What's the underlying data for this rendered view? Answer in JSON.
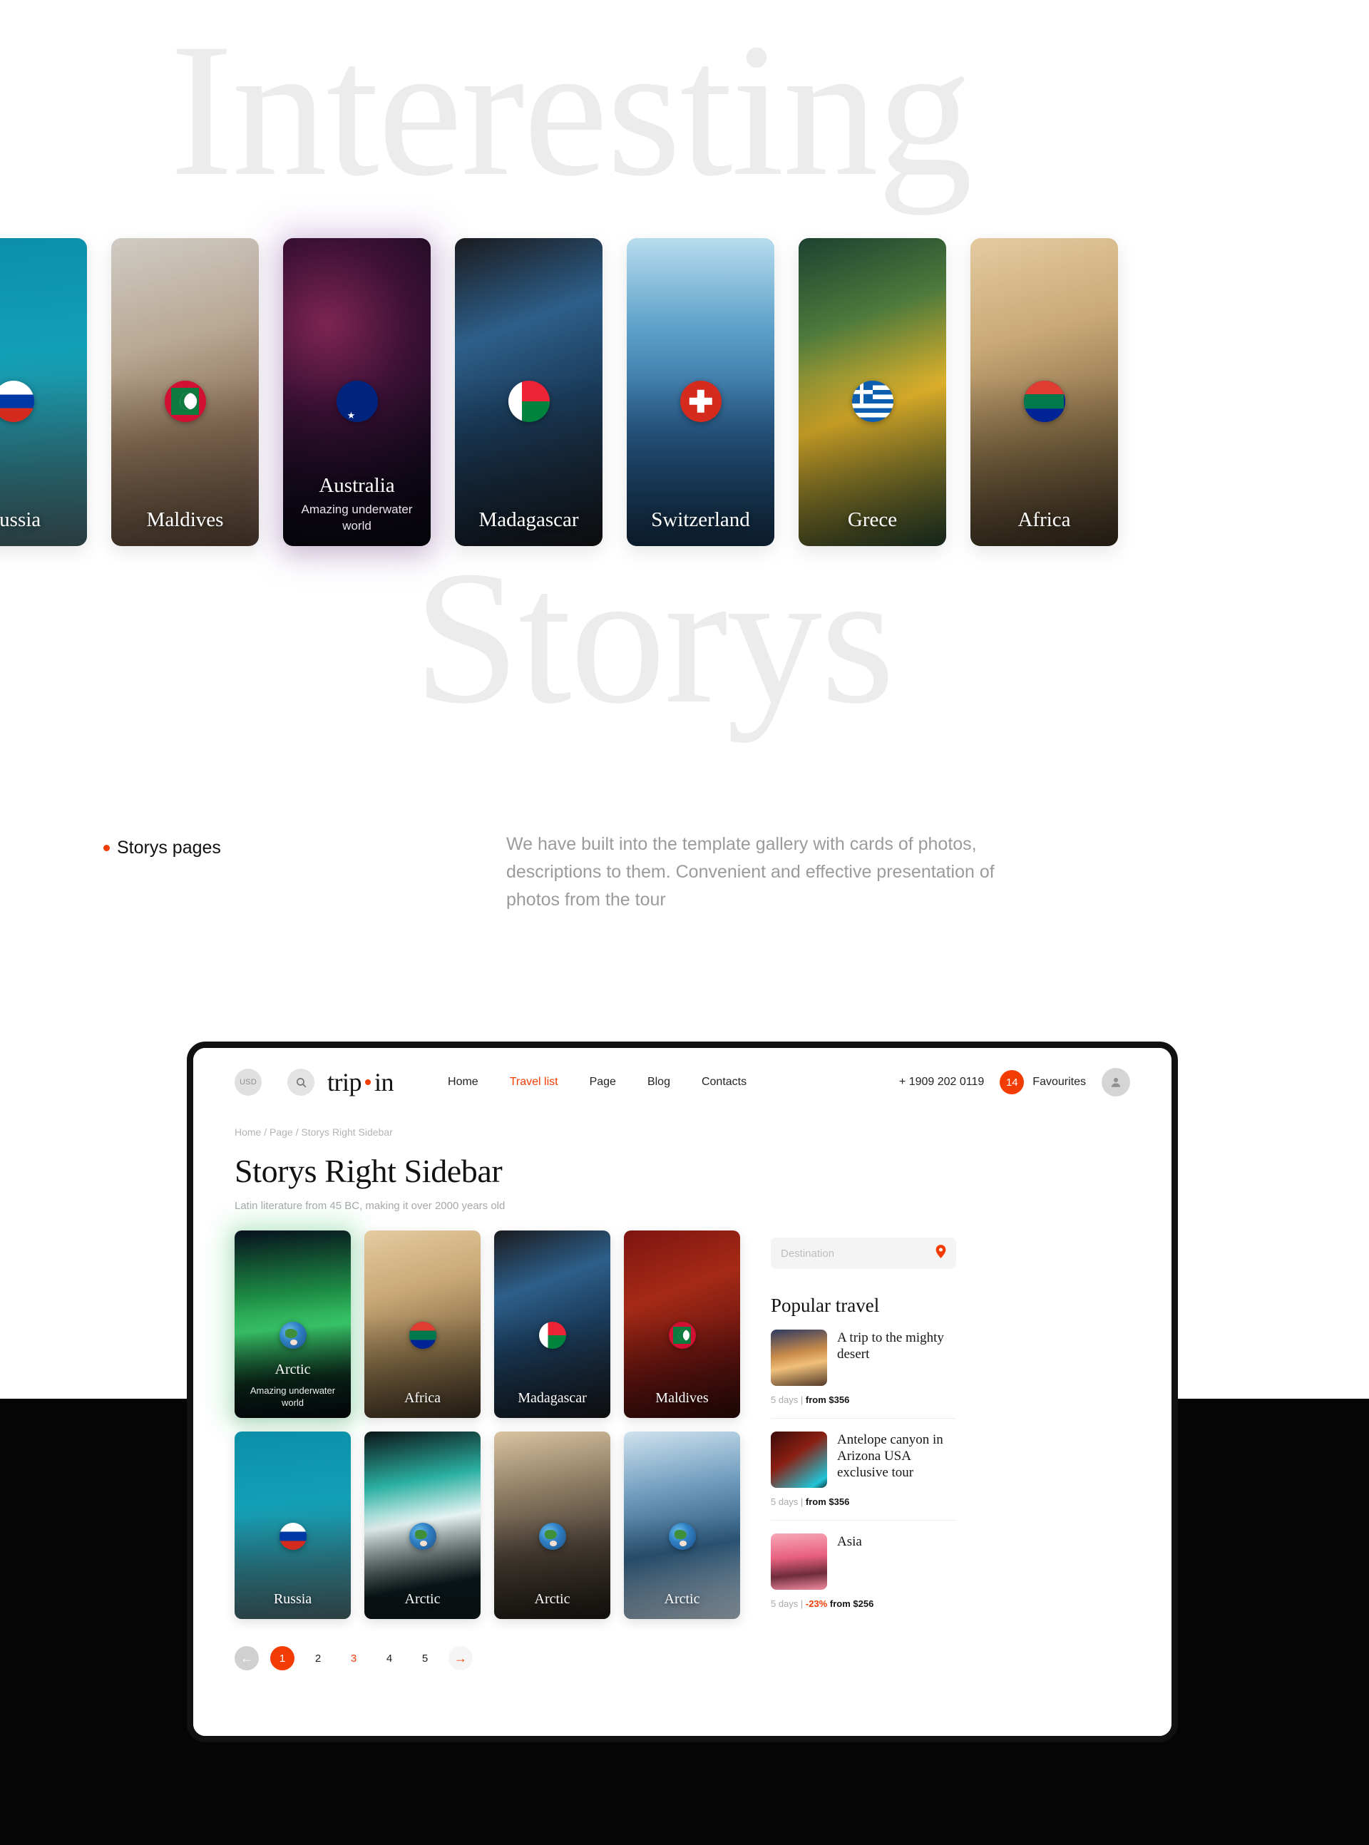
{
  "hero": {
    "watermark_top": "Interesting",
    "watermark_bottom": "Storys",
    "cards": [
      {
        "caption": "Russia",
        "subtitle": "",
        "flag": "flag-ru",
        "photo": "img-balloons",
        "featured": false
      },
      {
        "caption": "Maldives",
        "subtitle": "",
        "flag": "flag-mv",
        "photo": "img-pool",
        "featured": false
      },
      {
        "caption": "Australia",
        "subtitle": "Amazing underwater world",
        "flag": "flag-au",
        "photo": "img-jelly",
        "featured": true
      },
      {
        "caption": "Madagascar",
        "subtitle": "",
        "flag": "flag-mg",
        "photo": "img-bird",
        "featured": false
      },
      {
        "caption": "Switzerland",
        "subtitle": "",
        "flag": "flag-ch",
        "photo": "img-alps",
        "featured": false
      },
      {
        "caption": "Grece",
        "subtitle": "",
        "flag": "flag-gr",
        "photo": "img-lemon",
        "featured": false
      },
      {
        "caption": "Africa",
        "subtitle": "",
        "flag": "flag-za",
        "photo": "img-dune",
        "featured": false
      }
    ]
  },
  "intro": {
    "label": "Storys pages",
    "body": "We have built into the template gallery with cards of photos, descriptions to them. Convenient and effective presentation of photos from the tour"
  },
  "browser": {
    "topbar": {
      "currency": "USD",
      "search_icon": "search-icon",
      "logo_left": "trip",
      "logo_right": "in",
      "nav": [
        {
          "label": "Home",
          "active": false
        },
        {
          "label": "Travel list",
          "active": true
        },
        {
          "label": "Page",
          "active": false
        },
        {
          "label": "Blog",
          "active": false
        },
        {
          "label": "Contacts",
          "active": false
        }
      ],
      "phone": "+ 1909 202 0119",
      "favourites_count": "14",
      "favourites_label": "Favourites",
      "account_icon": "user-icon"
    },
    "breadcrumb": "Home / Page / Storys Right Sidebar",
    "page_title": "Storys Right Sidebar",
    "lede": "Latin literature from 45 BC, making it over 2000 years old",
    "gallery": [
      {
        "caption": "Arctic",
        "subtitle": "Amazing underwater world",
        "flag": "flag-globe",
        "photo": "img-aurora",
        "glow": true
      },
      {
        "caption": "Africa",
        "subtitle": "",
        "flag": "flag-za",
        "photo": "img-dune",
        "glow": false
      },
      {
        "caption": "Madagascar",
        "subtitle": "",
        "flag": "flag-mg",
        "photo": "img-bird",
        "glow": false
      },
      {
        "caption": "Maldives",
        "subtitle": "",
        "flag": "flag-mv",
        "photo": "img-maldives",
        "glow": false
      },
      {
        "caption": "Russia",
        "subtitle": "",
        "flag": "flag-ru",
        "photo": "img-balloons",
        "glow": false
      },
      {
        "caption": "Arctic",
        "subtitle": "",
        "flag": "flag-globe",
        "photo": "img-ice",
        "glow": false
      },
      {
        "caption": "Arctic",
        "subtitle": "",
        "flag": "flag-globe",
        "photo": "img-penguin",
        "glow": false
      },
      {
        "caption": "Arctic",
        "subtitle": "",
        "flag": "flag-globe",
        "photo": "img-berg",
        "glow": false
      }
    ],
    "pagination": {
      "prev_icon": "arrow-left-icon",
      "next_icon": "arrow-right-icon",
      "pages": [
        {
          "label": "1",
          "state": "current"
        },
        {
          "label": "2",
          "state": "normal"
        },
        {
          "label": "3",
          "state": "hot"
        },
        {
          "label": "4",
          "state": "normal"
        },
        {
          "label": "5",
          "state": "normal"
        }
      ]
    },
    "sidebar": {
      "destination_placeholder": "Destination",
      "pin_icon": "map-pin-icon",
      "heading": "Popular travel",
      "items": [
        {
          "title": "A trip to the mighty desert",
          "days": "5 days |",
          "discount": "",
          "price": "from $356",
          "photo": "img-desert-sm"
        },
        {
          "title": "Antelope canyon in Arizona USA exclusive tour",
          "days": "5 days |",
          "discount": "",
          "price": "from $356",
          "photo": "img-canyon"
        },
        {
          "title": "Asia",
          "days": "5 days |",
          "discount": "-23%",
          "price": "from $256",
          "photo": "img-asia"
        }
      ]
    }
  },
  "colors": {
    "accent": "#f33c04",
    "ink": "#121212",
    "muted": "#9b9b9b",
    "band": "#050505"
  }
}
